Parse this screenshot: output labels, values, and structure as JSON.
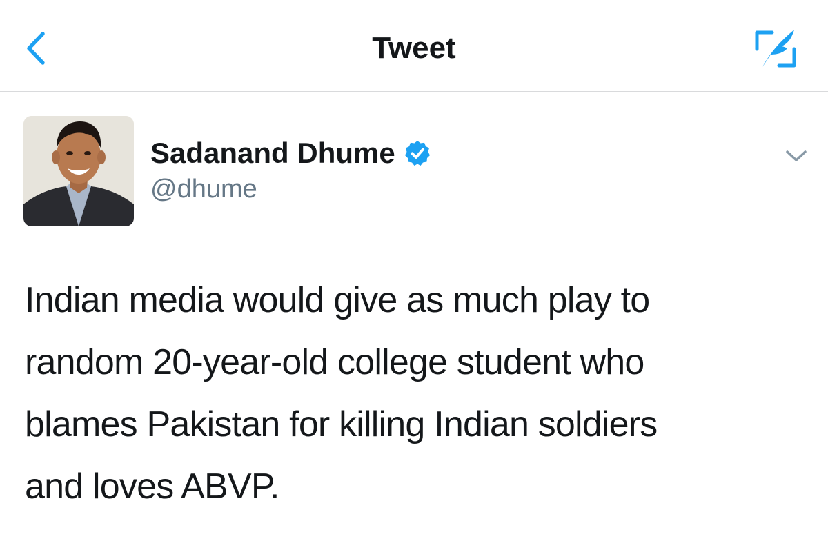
{
  "nav": {
    "title": "Tweet",
    "back_icon": "chevron-left-icon",
    "compose_icon": "compose-tweet-icon",
    "accent_color": "#1da1f2"
  },
  "tweet": {
    "author": {
      "display_name": "Sadanand Dhume",
      "handle": "@dhume",
      "verified": true
    },
    "text_lines": [
      "Indian media would give as much play to",
      "random 20-year-old college student who",
      "blames Pakistan for killing Indian soldiers",
      "and loves ABVP."
    ],
    "menu_icon": "chevron-down-icon"
  }
}
